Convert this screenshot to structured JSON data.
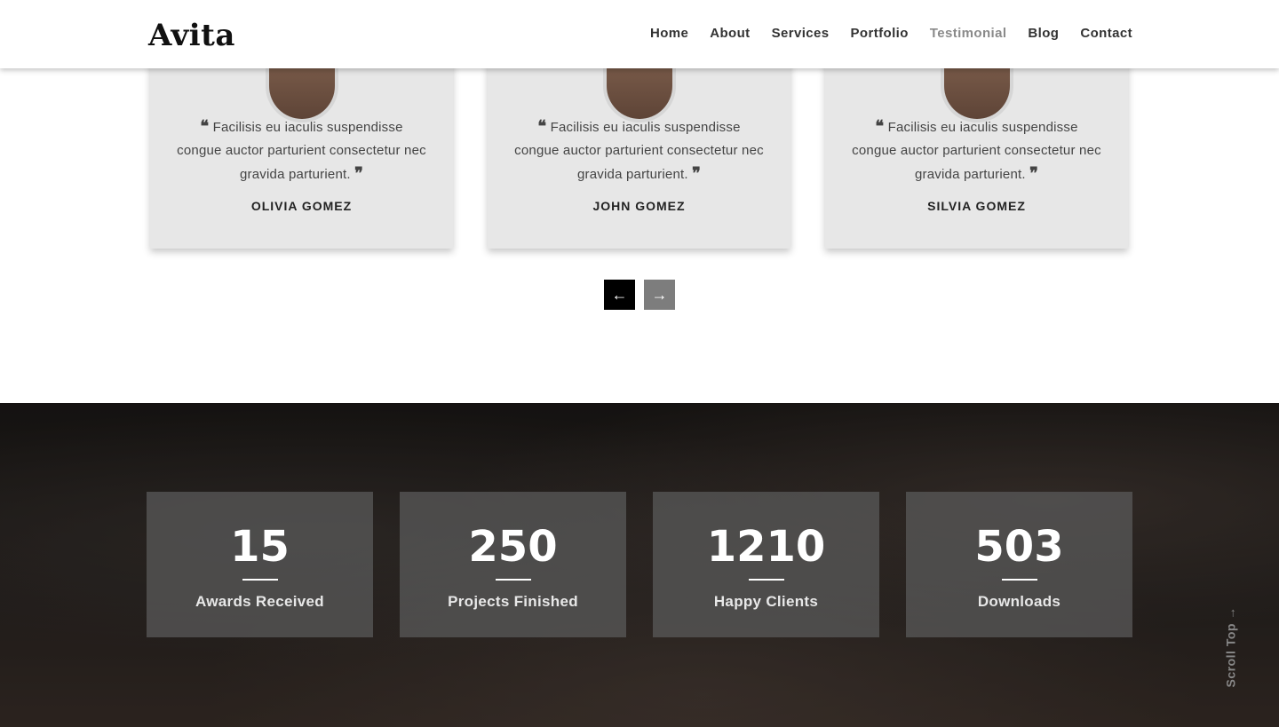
{
  "brand": {
    "logo": "Avita"
  },
  "nav": {
    "items": [
      {
        "label": "Home"
      },
      {
        "label": "About"
      },
      {
        "label": "Services"
      },
      {
        "label": "Portfolio"
      },
      {
        "label": "Testimonial",
        "active": true
      },
      {
        "label": "Blog"
      },
      {
        "label": "Contact"
      }
    ]
  },
  "testimonials": {
    "cards": [
      {
        "quote": "Facilisis eu iaculis suspendisse congue auctor parturient consectetur nec gravida parturient.",
        "author": "OLIVIA GOMEZ"
      },
      {
        "quote": "Facilisis eu iaculis suspendisse congue auctor parturient consectetur nec gravida parturient.",
        "author": "JOHN GOMEZ"
      },
      {
        "quote": "Facilisis eu iaculis suspendisse congue auctor parturient consectetur nec gravida parturient.",
        "author": "SILVIA GOMEZ"
      }
    ],
    "prev_icon": "arrow-left-icon",
    "next_icon": "arrow-right-icon"
  },
  "stats": [
    {
      "value": "15",
      "label": "Awards Received"
    },
    {
      "value": "250",
      "label": "Projects Finished"
    },
    {
      "value": "1210",
      "label": "Happy Clients"
    },
    {
      "value": "503",
      "label": "Downloads"
    }
  ],
  "scroll_top": {
    "label": "Scroll Top"
  },
  "colors": {
    "nav_active": "#8a8a8a",
    "card_bg": "#e7e7e7",
    "stat_box": "#5a5a5a"
  }
}
